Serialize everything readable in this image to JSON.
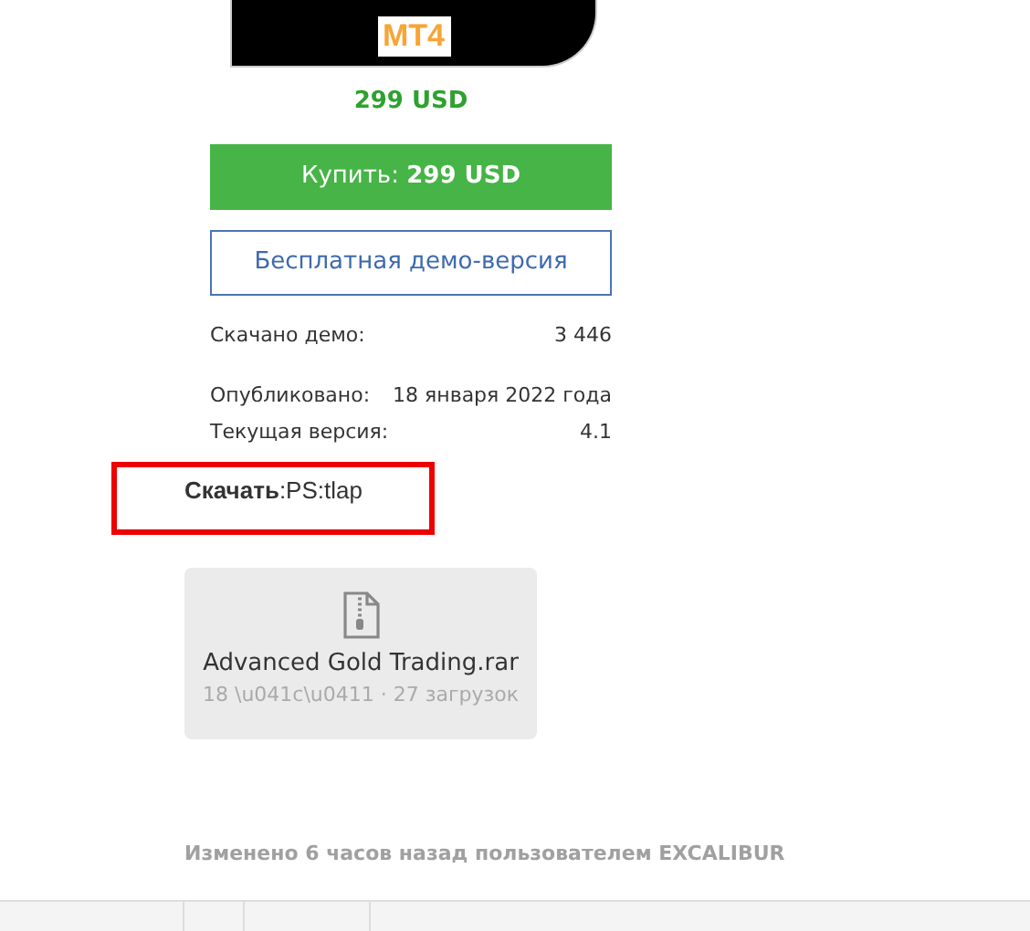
{
  "product": {
    "platform_badge": "MT4",
    "price": "299 USD",
    "buy_button": {
      "label": "Купить:",
      "price": "299 USD"
    },
    "demo_button": "Бесплатная демо-версия"
  },
  "stats": [
    {
      "label": "Скачано демо:",
      "value": "3 446"
    },
    {
      "label": "Опубликовано:",
      "value": "18 января 2022 года"
    },
    {
      "label": "Текущая версия:",
      "value": "4.1"
    }
  ],
  "download": {
    "label": "Скачать",
    "value": ":PS:tlap",
    "highlighted": true
  },
  "file": {
    "name": "Advanced Gold Trading.rar",
    "meta": "18 \\u041c\\u0411 · 27 загрузок"
  },
  "footer": "Изменено 6 часов назад пользователем EXCALIBUR"
}
